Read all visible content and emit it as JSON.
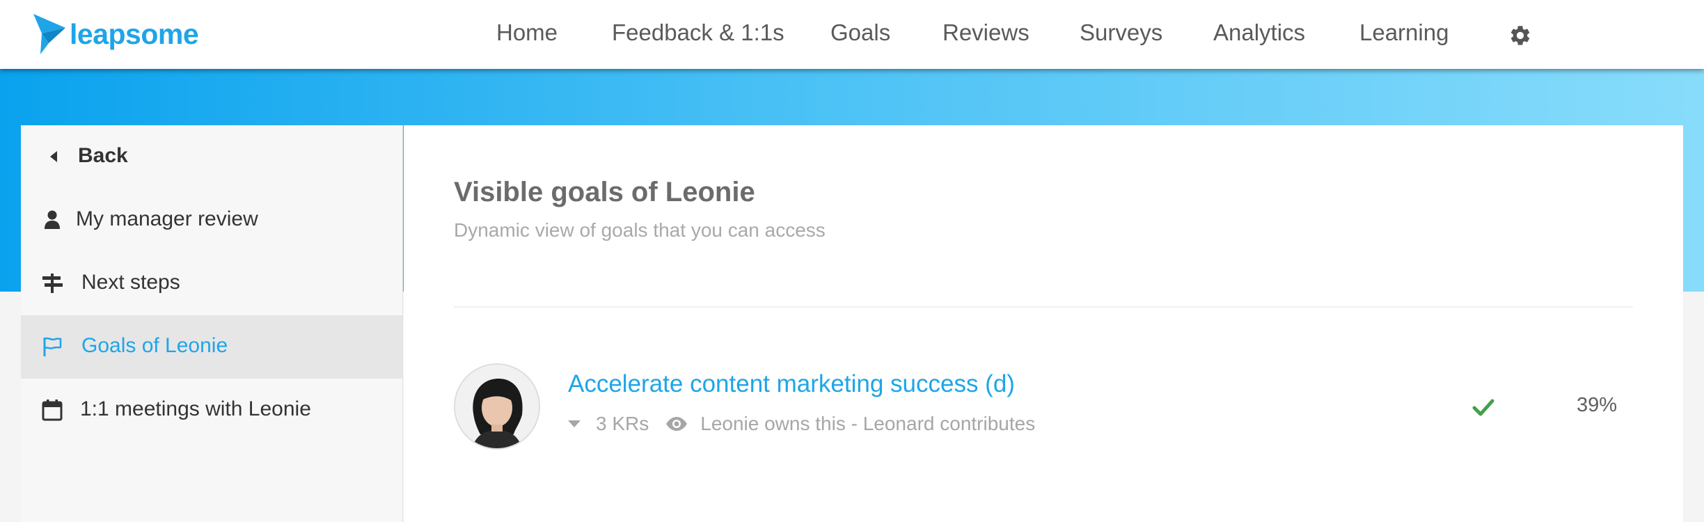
{
  "app": {
    "brand": "leapsome",
    "brand_color": "#1ea5e8"
  },
  "nav": {
    "items": [
      {
        "label": "Home"
      },
      {
        "label": "Feedback & 1:1s"
      },
      {
        "label": "Goals"
      },
      {
        "label": "Reviews"
      },
      {
        "label": "Surveys"
      },
      {
        "label": "Analytics"
      },
      {
        "label": "Learning"
      }
    ],
    "settings_icon": "gear-icon"
  },
  "sidebar": {
    "items": [
      {
        "label": "Back",
        "icon": "caret-left-icon"
      },
      {
        "label": "My manager review",
        "icon": "user-icon"
      },
      {
        "label": "Next steps",
        "icon": "signpost-icon"
      },
      {
        "label": "Goals of Leonie",
        "icon": "flag-icon",
        "active": true
      },
      {
        "label": "1:1 meetings with Leonie",
        "icon": "calendar-icon"
      }
    ]
  },
  "main": {
    "title": "Visible goals of Leonie",
    "subtitle": "Dynamic view of goals that you can access",
    "goals": [
      {
        "title": "Accelerate content marketing success (d)",
        "krs": "3 KRs",
        "ownership": "Leonie owns this - Leonard contributes",
        "status_icon": "check-icon",
        "status_color": "#43a047",
        "progress": "39%"
      }
    ]
  }
}
